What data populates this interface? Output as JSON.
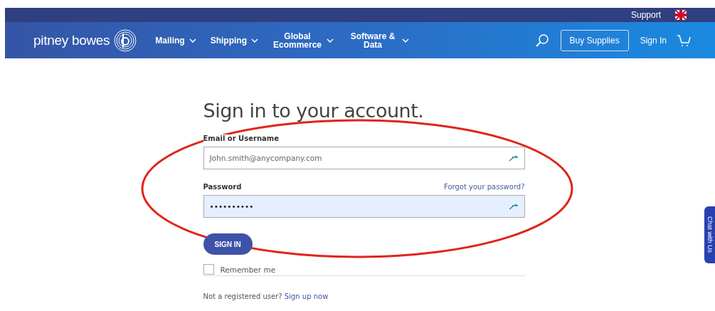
{
  "utility_bar": {
    "links": [
      "Support"
    ]
  },
  "header": {
    "logo": "pitney bowes",
    "nav": [
      "Mailing",
      "Shipping",
      "Global Ecommerce",
      "Software & Data"
    ],
    "buy_button": "Buy Supplies",
    "sign_in_link": "Sign In"
  },
  "form": {
    "title": "Sign in to your account.",
    "email": {
      "label": "Email or Username",
      "value": "John.smith@anycompany.com"
    },
    "password": {
      "label": "Password",
      "forgot_link": "Forgot your password?",
      "value": "••••••••••",
      "focused": true
    },
    "submit": "SIGN IN",
    "remember": {
      "label": "Remember me",
      "checked": false
    },
    "register": {
      "text": "Not a registered user?",
      "link": "Sign up now"
    }
  },
  "chat_tab": "Chat with Us"
}
